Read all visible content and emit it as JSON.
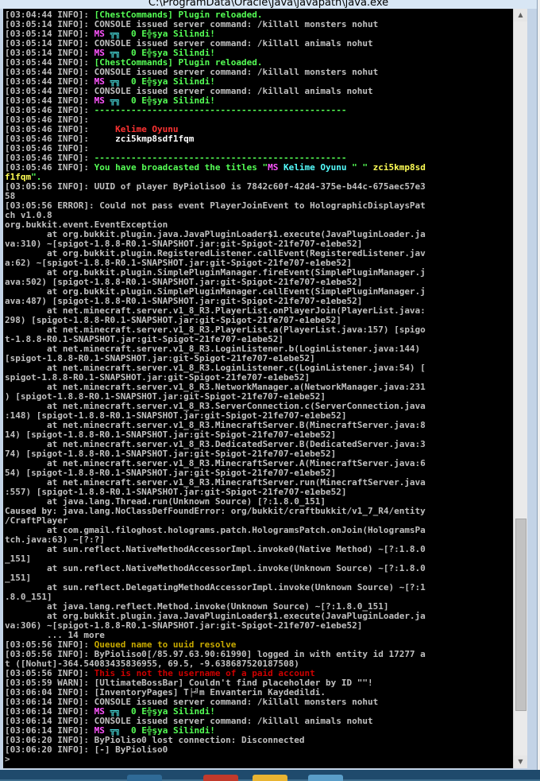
{
  "window": {
    "title": "C:\\ProgramData\\Oracle\\Java\\javapath\\java.exe"
  },
  "console": {
    "lines": [
      [
        {
          "t": "[03:04:44 INFO]: "
        },
        {
          "t": "[ChestCommands] Plugin reloaded.",
          "c": "green"
        }
      ],
      [
        {
          "t": "[03:05:14 INFO]: CONSOLE issued server command: /killall monsters nohut"
        }
      ],
      [
        {
          "t": "[03:05:14 INFO]: "
        },
        {
          "t": "MS",
          "c": "mag"
        },
        {
          "t": " ╦╗  ",
          "c": "aqua"
        },
        {
          "t": "0 ",
          "c": "green"
        },
        {
          "t": "E╬şya Silindi!",
          "c": "green"
        }
      ],
      [
        {
          "t": "[03:05:14 INFO]: CONSOLE issued server command: /killall animals nohut"
        }
      ],
      [
        {
          "t": "[03:05:14 INFO]: "
        },
        {
          "t": "MS",
          "c": "mag"
        },
        {
          "t": " ╦╗  ",
          "c": "aqua"
        },
        {
          "t": "0 ",
          "c": "green"
        },
        {
          "t": "E╬şya Silindi!",
          "c": "green"
        }
      ],
      [
        {
          "t": "[03:05:44 INFO]: "
        },
        {
          "t": "[ChestCommands] Plugin reloaded.",
          "c": "green"
        }
      ],
      [
        {
          "t": "[03:05:44 INFO]: CONSOLE issued server command: /killall monsters nohut"
        }
      ],
      [
        {
          "t": "[03:05:44 INFO]: "
        },
        {
          "t": "MS",
          "c": "mag"
        },
        {
          "t": " ╦╗  ",
          "c": "aqua"
        },
        {
          "t": "0 ",
          "c": "green"
        },
        {
          "t": "E╬şya Silindi!",
          "c": "green"
        }
      ],
      [
        {
          "t": "[03:05:44 INFO]: CONSOLE issued server command: /killall animals nohut"
        }
      ],
      [
        {
          "t": "[03:05:44 INFO]: "
        },
        {
          "t": "MS",
          "c": "mag"
        },
        {
          "t": " ╦╗  ",
          "c": "aqua"
        },
        {
          "t": "0 ",
          "c": "green"
        },
        {
          "t": "E╬şya Silindi!",
          "c": "green"
        }
      ],
      [
        {
          "t": "[03:05:46 INFO]: "
        },
        {
          "t": "------------------------------------------------",
          "c": "green"
        }
      ],
      [
        {
          "t": "[03:05:46 INFO]:"
        }
      ],
      [
        {
          "t": "[03:05:46 INFO]:     "
        },
        {
          "t": "Kelime Oyunu",
          "c": "red"
        }
      ],
      [
        {
          "t": "[03:05:46 INFO]:     "
        },
        {
          "t": "zci5kmp8sdf1fqm",
          "c": "white"
        }
      ],
      [
        {
          "t": "[03:05:46 INFO]:"
        }
      ],
      [
        {
          "t": "[03:05:46 INFO]: "
        },
        {
          "t": "------------------------------------------------",
          "c": "green"
        }
      ],
      [
        {
          "t": "[03:05:46 INFO]: "
        },
        {
          "t": "You have broadcasted the titles \"",
          "c": "green"
        },
        {
          "t": "MS",
          "c": "mag"
        },
        {
          "t": " Kelime Oyunu",
          "c": "aqua"
        },
        {
          "t": " \" \" ",
          "c": "green"
        },
        {
          "t": "zci5kmp8sd",
          "c": "yellow"
        }
      ],
      [
        {
          "t": "f1fqm",
          "c": "yellow"
        },
        {
          "t": "\".",
          "c": "green"
        }
      ],
      [
        {
          "t": "[03:05:56 INFO]: UUID of player ByPioliso0 is 7842c60f-42d4-375e-b44c-675aec57e3"
        }
      ],
      [
        {
          "t": "58"
        }
      ],
      [
        {
          "t": "[03:05:56 ERROR]: Could not pass event PlayerJoinEvent to HolographicDisplaysPat"
        }
      ],
      [
        {
          "t": "ch v1.0.8"
        }
      ],
      [
        {
          "t": "org.bukkit.event.EventException"
        }
      ],
      [
        {
          "t": "        at org.bukkit.plugin.java.JavaPluginLoader$1.execute(JavaPluginLoader.ja"
        }
      ],
      [
        {
          "t": "va:310) ~[spigot-1.8.8-R0.1-SNAPSHOT.jar:git-Spigot-21fe707-e1ebe52]"
        }
      ],
      [
        {
          "t": "        at org.bukkit.plugin.RegisteredListener.callEvent(RegisteredListener.jav"
        }
      ],
      [
        {
          "t": "a:62) ~[spigot-1.8.8-R0.1-SNAPSHOT.jar:git-Spigot-21fe707-e1ebe52]"
        }
      ],
      [
        {
          "t": "        at org.bukkit.plugin.SimplePluginManager.fireEvent(SimplePluginManager.j"
        }
      ],
      [
        {
          "t": "ava:502) [spigot-1.8.8-R0.1-SNAPSHOT.jar:git-Spigot-21fe707-e1ebe52]"
        }
      ],
      [
        {
          "t": "        at org.bukkit.plugin.SimplePluginManager.callEvent(SimplePluginManager.j"
        }
      ],
      [
        {
          "t": "ava:487) [spigot-1.8.8-R0.1-SNAPSHOT.jar:git-Spigot-21fe707-e1ebe52]"
        }
      ],
      [
        {
          "t": "        at net.minecraft.server.v1_8_R3.PlayerList.onPlayerJoin(PlayerList.java:"
        }
      ],
      [
        {
          "t": "298) [spigot-1.8.8-R0.1-SNAPSHOT.jar:git-Spigot-21fe707-e1ebe52]"
        }
      ],
      [
        {
          "t": "        at net.minecraft.server.v1_8_R3.PlayerList.a(PlayerList.java:157) [spigo"
        }
      ],
      [
        {
          "t": "t-1.8.8-R0.1-SNAPSHOT.jar:git-Spigot-21fe707-e1ebe52]"
        }
      ],
      [
        {
          "t": "        at net.minecraft.server.v1_8_R3.LoginListener.b(LoginListener.java:144)"
        }
      ],
      [
        {
          "t": "[spigot-1.8.8-R0.1-SNAPSHOT.jar:git-Spigot-21fe707-e1ebe52]"
        }
      ],
      [
        {
          "t": "        at net.minecraft.server.v1_8_R3.LoginListener.c(LoginListener.java:54) ["
        }
      ],
      [
        {
          "t": "spigot-1.8.8-R0.1-SNAPSHOT.jar:git-Spigot-21fe707-e1ebe52]"
        }
      ],
      [
        {
          "t": "        at net.minecraft.server.v1_8_R3.NetworkManager.a(NetworkManager.java:231"
        }
      ],
      [
        {
          "t": ") [spigot-1.8.8-R0.1-SNAPSHOT.jar:git-Spigot-21fe707-e1ebe52]"
        }
      ],
      [
        {
          "t": "        at net.minecraft.server.v1_8_R3.ServerConnection.c(ServerConnection.java"
        }
      ],
      [
        {
          "t": ":148) [spigot-1.8.8-R0.1-SNAPSHOT.jar:git-Spigot-21fe707-e1ebe52]"
        }
      ],
      [
        {
          "t": "        at net.minecraft.server.v1_8_R3.MinecraftServer.B(MinecraftServer.java:8"
        }
      ],
      [
        {
          "t": "14) [spigot-1.8.8-R0.1-SNAPSHOT.jar:git-Spigot-21fe707-e1ebe52]"
        }
      ],
      [
        {
          "t": "        at net.minecraft.server.v1_8_R3.DedicatedServer.B(DedicatedServer.java:3"
        }
      ],
      [
        {
          "t": "74) [spigot-1.8.8-R0.1-SNAPSHOT.jar:git-Spigot-21fe707-e1ebe52]"
        }
      ],
      [
        {
          "t": "        at net.minecraft.server.v1_8_R3.MinecraftServer.A(MinecraftServer.java:6"
        }
      ],
      [
        {
          "t": "54) [spigot-1.8.8-R0.1-SNAPSHOT.jar:git-Spigot-21fe707-e1ebe52]"
        }
      ],
      [
        {
          "t": "        at net.minecraft.server.v1_8_R3.MinecraftServer.run(MinecraftServer.java"
        }
      ],
      [
        {
          "t": ":557) [spigot-1.8.8-R0.1-SNAPSHOT.jar:git-Spigot-21fe707-e1ebe52]"
        }
      ],
      [
        {
          "t": "        at java.lang.Thread.run(Unknown Source) [?:1.8.0_151]"
        }
      ],
      [
        {
          "t": "Caused by: java.lang.NoClassDefFoundError: org/bukkit/craftbukkit/v1_7_R4/entity"
        }
      ],
      [
        {
          "t": "/CraftPlayer"
        }
      ],
      [
        {
          "t": "        at com.gmail.filoghost.holograms.patch.HologramsPatch.onJoin(HologramsPa"
        }
      ],
      [
        {
          "t": "tch.java:63) ~[?:?]"
        }
      ],
      [
        {
          "t": "        at sun.reflect.NativeMethodAccessorImpl.invoke0(Native Method) ~[?:1.8.0"
        }
      ],
      [
        {
          "t": "_151]"
        }
      ],
      [
        {
          "t": "        at sun.reflect.NativeMethodAccessorImpl.invoke(Unknown Source) ~[?:1.8.0"
        }
      ],
      [
        {
          "t": "_151]"
        }
      ],
      [
        {
          "t": "        at sun.reflect.DelegatingMethodAccessorImpl.invoke(Unknown Source) ~[?:1"
        }
      ],
      [
        {
          "t": ".8.0_151]"
        }
      ],
      [
        {
          "t": "        at java.lang.reflect.Method.invoke(Unknown Source) ~[?:1.8.0_151]"
        }
      ],
      [
        {
          "t": "        at org.bukkit.plugin.java.JavaPluginLoader$1.execute(JavaPluginLoader.ja"
        }
      ],
      [
        {
          "t": "va:306) ~[spigot-1.8.8-R0.1-SNAPSHOT.jar:git-Spigot-21fe707-e1ebe52]"
        }
      ],
      [
        {
          "t": "        ... 14 more"
        }
      ],
      [
        {
          "t": "[03:05:56 INFO]: "
        },
        {
          "t": "Queued name to uuid resolve",
          "c": "gold"
        }
      ],
      [
        {
          "t": "[03:05:56 INFO]: ByPioliso0[/85.97.63.90:61990] logged in with entity id 17277 a"
        }
      ],
      [
        {
          "t": "t ([Nohut]-364.54083435836955, 69.5, -9.638687520187508)"
        }
      ],
      [
        {
          "t": "[03:05:56 INFO]: "
        },
        {
          "t": "This is not the username of a paid account",
          "c": "dred"
        }
      ],
      [
        {
          "t": "[03:05:59 WARN]: [UltimateBossBar] Couldn't find placeholder by ID \"\"!"
        }
      ],
      [
        {
          "t": "[03:06:04 INFO]: [InventoryPages] T├╝m Envanterin Kaydedildi."
        }
      ],
      [
        {
          "t": "[03:06:14 INFO]: CONSOLE issued server command: /killall monsters nohut"
        }
      ],
      [
        {
          "t": "[03:06:14 INFO]: "
        },
        {
          "t": "MS",
          "c": "mag"
        },
        {
          "t": " ╦╗  ",
          "c": "aqua"
        },
        {
          "t": "0 ",
          "c": "green"
        },
        {
          "t": "E╬şya Silindi!",
          "c": "green"
        }
      ],
      [
        {
          "t": "[03:06:14 INFO]: CONSOLE issued server command: /killall animals nohut"
        }
      ],
      [
        {
          "t": "[03:06:14 INFO]: "
        },
        {
          "t": "MS",
          "c": "mag"
        },
        {
          "t": " ╦╗  ",
          "c": "aqua"
        },
        {
          "t": "0 ",
          "c": "green"
        },
        {
          "t": "E╬şya Silindi!",
          "c": "green"
        }
      ],
      [
        {
          "t": "[03:06:20 INFO]: ByPioliso0 lost connection: Disconnected"
        }
      ],
      [
        {
          "t": "[03:06:20 INFO]: [-] ByPioliso0"
        }
      ],
      [
        {
          "t": ">"
        }
      ]
    ]
  },
  "scrollbar": {
    "up_glyph": "▲",
    "down_glyph": "▼",
    "thumb_position": 0.92
  }
}
